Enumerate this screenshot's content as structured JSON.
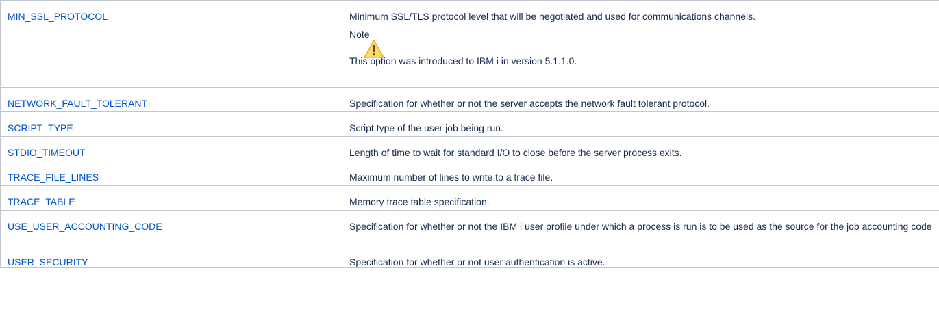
{
  "options": [
    {
      "name": "MIN_SSL_PROTOCOL",
      "description": "Minimum SSL/TLS protocol level that will be negotiated and used for communications channels.",
      "note": {
        "title": "Note",
        "icon": "warning-icon",
        "body": "This option was introduced to IBM i in version 5.1.1.0."
      }
    },
    {
      "name": "NETWORK_FAULT_TOLERANT",
      "description": "Specification for whether or not the server accepts the network fault tolerant protocol."
    },
    {
      "name": "SCRIPT_TYPE",
      "description": "Script type of the user job being run."
    },
    {
      "name": "STDIO_TIMEOUT",
      "description": "Length of time to wait for standard I/O to close before the server process exits."
    },
    {
      "name": "TRACE_FILE_LINES",
      "description": "Maximum number of lines to write to a trace file."
    },
    {
      "name": "TRACE_TABLE",
      "description": "Memory trace table specification."
    },
    {
      "name": "USE_USER_ACCOUNTING_CODE",
      "description": "Specification for whether or not the IBM i user profile under which a process is run is to be used as the source for the job accounting code"
    },
    {
      "name": "USER_SECURITY",
      "description": "Specification for whether or not user authentication is active."
    }
  ],
  "colors": {
    "link": "#0052cc",
    "text": "#172b4d",
    "border": "#c1c7d0",
    "warning_fill": "#ffd351",
    "warning_stroke": "#e8a200"
  }
}
